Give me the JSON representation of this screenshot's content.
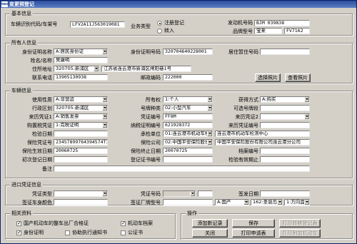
{
  "window": {
    "title": "变更预登记",
    "app_icon": "app-icon"
  },
  "basic": {
    "title": "基本信息",
    "vin_label": "车辆识别代码/车架号",
    "vin_value": "LFV2A11J563019081",
    "biz_type_label": "业务类型",
    "biz_types": [
      "注册登记",
      "转入"
    ],
    "selected_biz_type": "注册登记",
    "engine_label": "发动机号码",
    "engine_value": "BJM 039838",
    "brand_label": "品牌型号",
    "brand_value": "宝来",
    "model_value": "FV7162"
  },
  "owner": {
    "title": "所有人信息",
    "id_type_label": "身份证明名称",
    "id_type_value": "A:居民身份证",
    "id_no_label": "身份证明号码",
    "id_no_value": "320704640228001",
    "residence_label": "居住暂住号码",
    "residence_value": "",
    "name_label": "姓名/名称",
    "name_value": "吴康明",
    "address_label": "住所地址",
    "district_value": "320705:新浦区",
    "address_value": "江苏省连云港市新浦区闸阳巷1号",
    "phone_label": "联系电话",
    "phone_value": "13905130938",
    "zip_label": "邮政编码",
    "zip_value": "222000",
    "select_btn": "选择照片",
    "view_btn": "查看照片"
  },
  "vehicle": {
    "title": "车辆信息",
    "use_label": "使用性质",
    "use_value": "A:非营运",
    "owner_type_label": "所有权",
    "owner_type_value": "1:个人",
    "acquire_label": "获得方式",
    "acquire_value": "A:购买",
    "admin_area_label": "行政区划",
    "admin_area_value": "320705:新浦区",
    "plate_type_label": "号牌种类",
    "plate_type_value": "02:小型汽车",
    "plate_no_label": "可选号牌段",
    "plate_no_value": "",
    "origin1_label": "来历凭证1",
    "origin1_value": "A:销售发票",
    "cert1_no_label": "凭证编号",
    "cert1_no_value": "FF8M",
    "origin2_label": "来历凭证2",
    "origin2_value": "",
    "tax_label": "购置税凭证",
    "tax_value": "1:完税证明",
    "tax_no_label": "纳税证明编号",
    "tax_no_value": "621928372",
    "origin_cert_label": "来历凭证编号",
    "origin_cert_value": "",
    "inspect_date_label": "检验日期",
    "inspect_date_value": "",
    "inspect_org_label": "承检单位",
    "inspect_org_code": "01:连云港市机动车检",
    "inspect_org_value": "连云港市机动车检测中心",
    "insure_no_label": "保险凭证号",
    "insure_no_value": "23457899764394574T3",
    "insure_co_label": "保险公司",
    "insure_co_code": "02:中国平安保险股份",
    "insure_co_value": "中国平安保险股份有限公司连云港分公司",
    "insure_start_label": "保险生效日期",
    "insure_start_value": "20060725",
    "insure_end_label": "保险终止日期",
    "insure_end_value": "20070725",
    "archive_no_label": "档案编号",
    "archive_no_value": "",
    "first_reg_label": "初次登记日期",
    "first_reg_value": "",
    "reg_cert_label": "登记证书编号",
    "reg_cert_value": "",
    "valid_until_label": "检验有效期止",
    "valid_until_value": "",
    "note_label": "备注",
    "note_value": ""
  },
  "import": {
    "title": "进口凭证信息",
    "cert_type_label": "凭证类型",
    "cert_type_value": "",
    "cert_no_label": "凭证号码",
    "cert_no_value": "",
    "issue_date_label": "签发日期",
    "issue_date_value": "",
    "body_color_label": "签证车身颜色",
    "body_color_value": "",
    "factory_label": "签证厂牌型号",
    "factory_value": "",
    "country_value": "A:国产",
    "plate_seg_value": "162:圣诞岛",
    "steer_value": "1:方向盘"
  },
  "materials": {
    "title": "相关资料",
    "items": [
      {
        "label": "国产机动车的整车出厂合格证",
        "checked": true
      },
      {
        "label": "机动车档案",
        "checked": true
      },
      {
        "label": "身份证明",
        "checked": true
      },
      {
        "label": "协助执行通知书",
        "checked": false
      },
      {
        "label": "公证书",
        "checked": false
      }
    ]
  },
  "ops": {
    "title": "操作",
    "add_btn": "添加新记录",
    "save_btn": "保存",
    "close_btn": "关闭",
    "print_btn": "打印申请表",
    "print_transfer_btn": "打印转移登记表",
    "print_attach_btn": "打印附加机动车",
    "checkmark": "✓"
  }
}
